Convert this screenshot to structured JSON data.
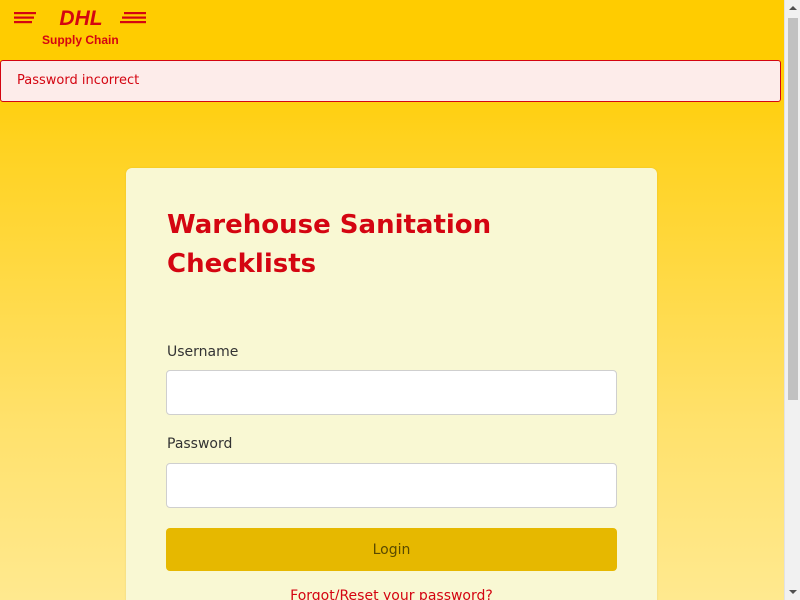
{
  "header": {
    "logo_text": "DHL",
    "logo_subtitle": "Supply Chain"
  },
  "alert": {
    "message": "Password incorrect"
  },
  "login_card": {
    "title": "Warehouse Sanitation Checklists",
    "username_label": "Username",
    "username_value": "",
    "password_label": "Password",
    "password_value": "",
    "login_button": "Login",
    "forgot_link": "Forgot/Reset your password?"
  },
  "colors": {
    "brand_yellow": "#ffcc00",
    "brand_red": "#d40511",
    "card_background": "#f9f8d3",
    "button_background": "#e6b800",
    "alert_background": "#fdecea"
  },
  "icons": {
    "scroll_up": "chevron-up-icon",
    "scroll_down": "chevron-down-icon"
  }
}
